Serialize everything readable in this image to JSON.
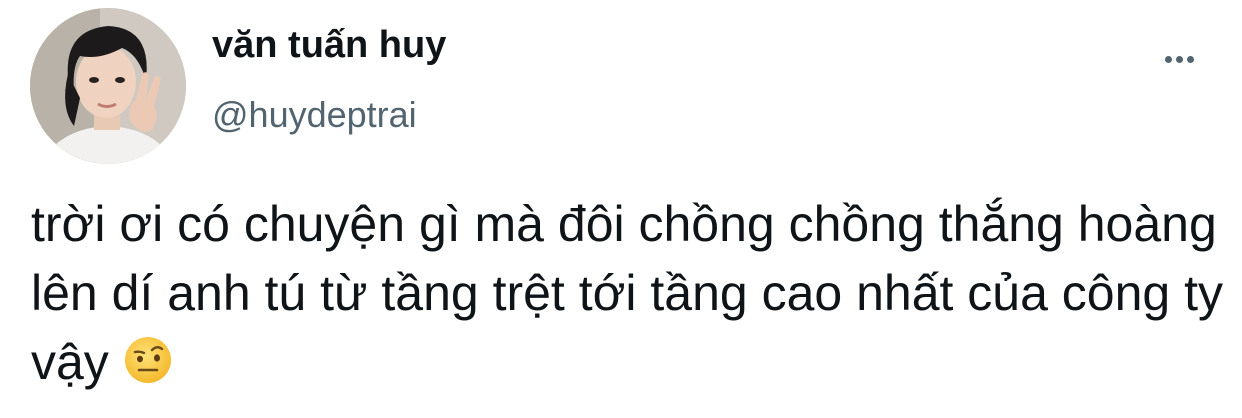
{
  "tweet": {
    "author": {
      "display_name": "văn tuấn huy",
      "handle": "@huydeptrai",
      "avatar_icon": "profile-photo"
    },
    "more_icon": "ellipsis-icon",
    "text": "trời ơi có chuyện gì mà đôi chồng chồng thắng hoàng lên dí anh tú từ tầng trệt tới tầng cao nhất của công ty vậy",
    "emoji": "face-with-raised-eyebrow"
  },
  "colors": {
    "text_primary": "#0f1419",
    "text_secondary": "#536471",
    "background": "#ffffff"
  }
}
